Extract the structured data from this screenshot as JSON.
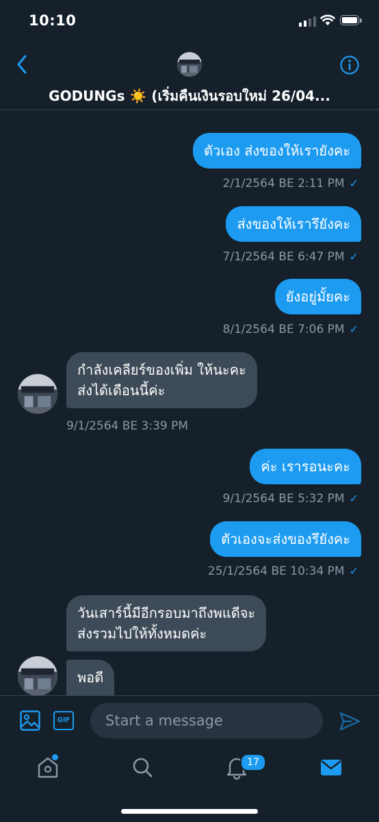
{
  "status_bar": {
    "time": "10:10"
  },
  "header": {
    "title": "GODUNGs ☀️ (เริ่มคืนเงินรอบใหม่ 26/04..."
  },
  "messages": [
    {
      "direction": "out",
      "text": "ตัวเอง ส่งของให้เรายังคะ",
      "timestamp": "2/1/2564 BE 2:11 PM"
    },
    {
      "direction": "out",
      "text": "ส่งของให้เรารึยังคะ",
      "timestamp": "7/1/2564 BE 6:47 PM"
    },
    {
      "direction": "out",
      "text": "ยังอยู่มั้ยคะ",
      "timestamp": "8/1/2564 BE 7:06 PM"
    },
    {
      "direction": "in",
      "lines": [
        "กำลังเคลียร์ของเพิ่ม ให้นะคะ",
        "ส่งได้เดือนนี้ค่ะ"
      ],
      "timestamp": "9/1/2564 BE 3:39 PM"
    },
    {
      "direction": "out",
      "text": "ค่ะ เรารอนะคะ",
      "timestamp": "9/1/2564 BE 5:32 PM"
    },
    {
      "direction": "out",
      "text": "ตัวเองจะส่งของรึยังคะ",
      "timestamp": "25/1/2564 BE 10:34 PM"
    },
    {
      "direction": "in",
      "lines": [
        "วันเสาร์นี้มีอีกรอบมาถึงพแดีจะ",
        "ส่งรวมไปให้ทั้งหมดค่ะ"
      ]
    },
    {
      "direction": "in",
      "text": "พอดี"
    }
  ],
  "composer": {
    "placeholder": "Start a message",
    "gif_label": "GIF"
  },
  "bottom_nav": {
    "notification_count": "17"
  },
  "colors": {
    "background": "#15202b",
    "accent": "#1d9bf0",
    "incoming_bubble": "#3d4a57",
    "muted_text": "#8b98a5"
  },
  "icons": [
    "back-chevron-icon",
    "info-icon",
    "image-icon",
    "gif-icon",
    "send-icon",
    "home-icon",
    "search-icon",
    "bell-icon",
    "mail-icon"
  ]
}
